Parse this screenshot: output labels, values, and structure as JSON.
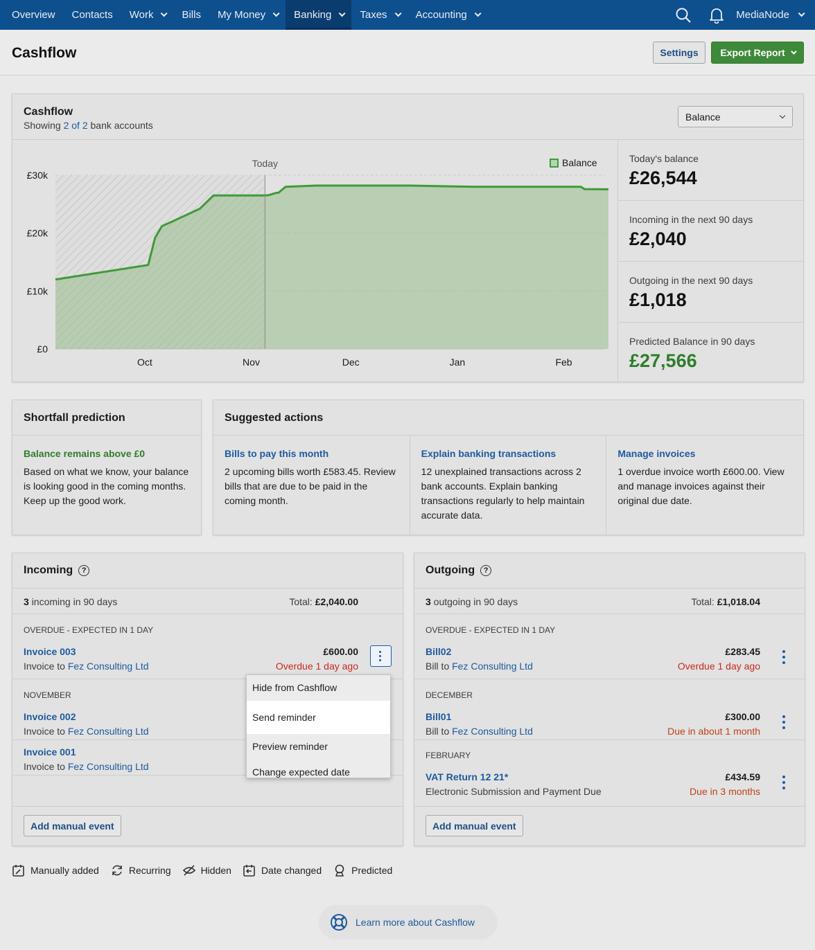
{
  "nav": {
    "items": [
      {
        "label": "Overview",
        "has_menu": false
      },
      {
        "label": "Contacts",
        "has_menu": false
      },
      {
        "label": "Work",
        "has_menu": true
      },
      {
        "label": "Bills",
        "has_menu": false
      },
      {
        "label": "My Money",
        "has_menu": true
      },
      {
        "label": "Banking",
        "has_menu": true,
        "active": true
      },
      {
        "label": "Taxes",
        "has_menu": true
      },
      {
        "label": "Accounting",
        "has_menu": true
      }
    ],
    "org_name": "MediaNode",
    "icons": [
      "search-icon",
      "bell-icon"
    ]
  },
  "header": {
    "title": "Cashflow",
    "settings_label": "Settings",
    "export_label": "Export Report"
  },
  "cashflow": {
    "title": "Cashflow",
    "showing_prefix": "Showing ",
    "showing_link": "2 of 2",
    "showing_suffix": " bank accounts",
    "select_value": "Balance"
  },
  "chart_data": {
    "type": "area",
    "title": "",
    "xlabel": "",
    "ylabel": "",
    "x_ticks": [
      "Oct",
      "Nov",
      "Dec",
      "Jan",
      "Feb"
    ],
    "y_ticks": [
      "£0",
      "£10k",
      "£20k",
      "£30k"
    ],
    "ylim": [
      0,
      30000
    ],
    "today_label": "Today",
    "legend": "top-right",
    "grid": true,
    "series": [
      {
        "name": "Balance",
        "color": "#3f9a39",
        "x": [
          "Sep 20",
          "Oct 17",
          "Oct 19",
          "Oct 21",
          "Oct 24",
          "Nov 1",
          "Nov 5",
          "Nov 14",
          "Nov 20",
          "Nov 21",
          "Nov 23",
          "Nov 24",
          "Nov 26",
          "Dec 5",
          "Jan 1",
          "Jan 20",
          "Feb 1",
          "Feb 20",
          "Feb 21",
          "Feb 28"
        ],
        "values": [
          12000,
          14500,
          19200,
          21200,
          22000,
          24200,
          26500,
          26500,
          26500,
          26544,
          26900,
          27000,
          28000,
          28200,
          28200,
          28000,
          28000,
          28000,
          27600,
          27566
        ]
      }
    ]
  },
  "stats": [
    {
      "label": "Today's balance",
      "value": "£26,544",
      "green": false
    },
    {
      "label": "Incoming in the next 90 days",
      "value": "£2,040",
      "green": false
    },
    {
      "label": "Outgoing in the next 90 days",
      "value": "£1,018",
      "green": false
    },
    {
      "label": "Predicted Balance in 90 days",
      "value": "£27,566",
      "green": true
    }
  ],
  "shortfall": {
    "title": "Shortfall prediction",
    "headline": "Balance remains above £0",
    "text": "Based on what we know, your balance is looking good in the coming months. Keep up the good work."
  },
  "suggested": {
    "title": "Suggested actions",
    "cols": [
      {
        "title": "Bills to pay this month",
        "text": "2 upcoming bills worth £583.45. Review bills that are due to be paid in the coming month."
      },
      {
        "title": "Explain banking transactions",
        "text": "12 unexplained transactions across 2 bank accounts. Explain banking transactions regularly to help maintain accurate data."
      },
      {
        "title": "Manage invoices",
        "text": "1 overdue invoice worth £600.00. View and manage invoices against their original due date."
      }
    ]
  },
  "incoming": {
    "title": "Incoming",
    "count_num": "3",
    "count_text": " incoming in 90 days",
    "total_label": "Total: ",
    "total_value": "£2,040.00",
    "sec1": "OVERDUE - EXPECTED IN 1 DAY",
    "sec2": "NOVEMBER",
    "inv3": {
      "title": "Invoice 003",
      "prefix": "Invoice to ",
      "contact": "Fez Consulting Ltd",
      "amount": "£600.00",
      "status": "Overdue 1 day ago"
    },
    "inv2": {
      "title": "Invoice 002",
      "prefix": "Invoice to ",
      "contact": "Fez Consulting Ltd"
    },
    "inv1": {
      "title": "Invoice 001",
      "prefix": "Invoice to ",
      "contact": "Fez Consulting Ltd"
    },
    "add_label": "Add manual event"
  },
  "menu": {
    "items": [
      "Hide from Cashflow",
      "Send reminder",
      "Preview reminder",
      "Change expected date"
    ]
  },
  "outgoing": {
    "title": "Outgoing",
    "count_num": "3",
    "count_text": " outgoing in 90 days",
    "total_label": "Total: ",
    "total_value": "£1,018.04",
    "sec1": "OVERDUE - EXPECTED IN 1 DAY",
    "sec2": "DECEMBER",
    "sec3": "FEBRUARY",
    "bill2": {
      "title": "Bill02",
      "prefix": "Bill to ",
      "contact": "Fez Consulting Ltd",
      "amount": "£283.45",
      "status": "Overdue 1 day ago"
    },
    "bill1": {
      "title": "Bill01",
      "prefix": "Bill to ",
      "contact": "Fez Consulting Ltd",
      "amount": "£300.00",
      "status": "Due in about 1 month"
    },
    "vat": {
      "title": "VAT Return 12 21*",
      "sub": "Electronic Submission and Payment Due",
      "amount": "£434.59",
      "status": "Due in 3 months"
    },
    "add_label": "Add manual event"
  },
  "legend": {
    "manual": "Manually added",
    "recurring": "Recurring",
    "hidden": "Hidden",
    "date_changed": "Date changed",
    "predicted": "Predicted"
  },
  "learn_more": "Learn more about Cashflow"
}
